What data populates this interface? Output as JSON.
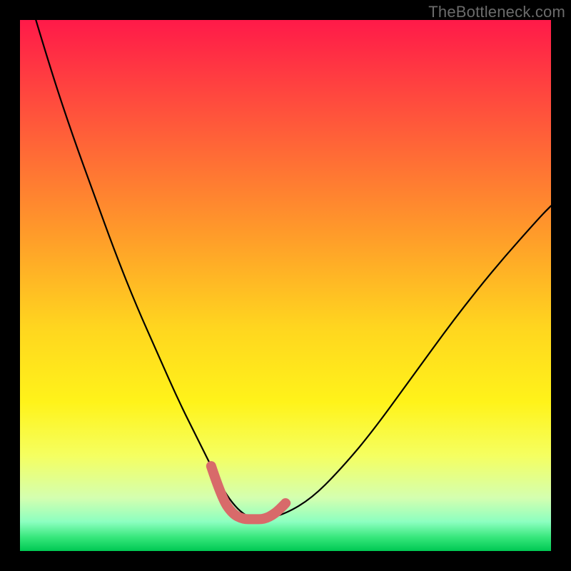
{
  "watermark": "TheBottleneck.com",
  "chart_data": {
    "type": "line",
    "title": "",
    "xlabel": "",
    "ylabel": "",
    "xlim": [
      0,
      100
    ],
    "ylim": [
      0,
      100
    ],
    "grid": false,
    "legend": false,
    "background_gradient_stops": [
      {
        "offset": 0.0,
        "color": "#ff1a49"
      },
      {
        "offset": 0.2,
        "color": "#ff5a3a"
      },
      {
        "offset": 0.4,
        "color": "#ff9a2a"
      },
      {
        "offset": 0.58,
        "color": "#ffd61f"
      },
      {
        "offset": 0.72,
        "color": "#fff31a"
      },
      {
        "offset": 0.82,
        "color": "#f5ff60"
      },
      {
        "offset": 0.9,
        "color": "#d4ffb0"
      },
      {
        "offset": 0.945,
        "color": "#8cffc0"
      },
      {
        "offset": 0.975,
        "color": "#35e67a"
      },
      {
        "offset": 1.0,
        "color": "#00c853"
      }
    ],
    "series": [
      {
        "name": "bottleneck-curve",
        "color": "#000000",
        "width": 2.2,
        "x": [
          3,
          6,
          10,
          14,
          18,
          22,
          26,
          30,
          34,
          36,
          38,
          40,
          42,
          44,
          46,
          50,
          55,
          60,
          66,
          74,
          82,
          90,
          98,
          100
        ],
        "y": [
          100,
          90,
          78,
          67,
          56,
          46,
          37,
          28,
          20,
          16,
          12,
          9,
          7,
          6,
          6,
          7,
          10,
          15,
          22,
          33,
          44,
          54,
          63,
          65
        ]
      },
      {
        "name": "optimal-highlight",
        "color": "#d86a6a",
        "width": 14,
        "linecap": "round",
        "x": [
          36,
          38,
          40,
          42,
          44,
          46,
          48,
          50
        ],
        "y": [
          16,
          10,
          7,
          6,
          6,
          6,
          7,
          9
        ]
      }
    ]
  }
}
